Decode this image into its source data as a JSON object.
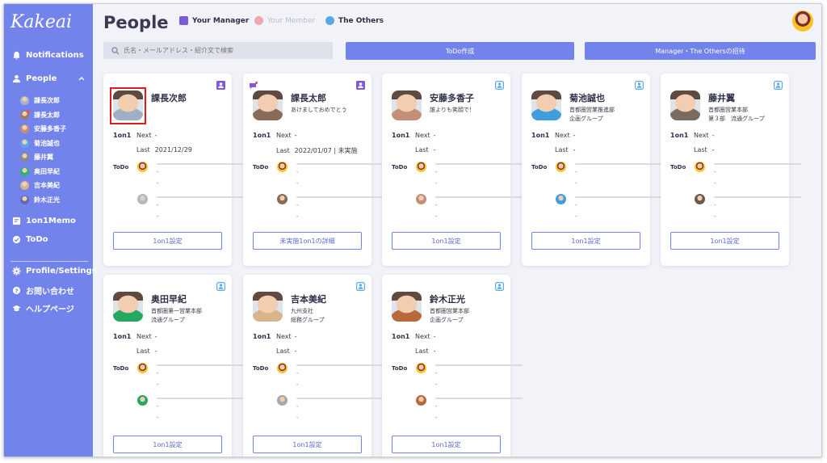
{
  "app": {
    "logo": "Kakeai"
  },
  "sidebar": {
    "notifications": "Notifications",
    "people": "People",
    "members": [
      {
        "name": "課長次郎",
        "color": "#a9b3c7"
      },
      {
        "name": "課長太郎",
        "color": "#9a7b66",
        "badge": true
      },
      {
        "name": "安藤多香子",
        "color": "#c48f78"
      },
      {
        "name": "菊池誠也",
        "color": "#5aa9e6"
      },
      {
        "name": "藤井翼",
        "color": "#8a8a8a"
      },
      {
        "name": "奥田早紀",
        "color": "#2fb36d"
      },
      {
        "name": "吉本美紀",
        "color": "#d2b48c"
      },
      {
        "name": "鈴木正光",
        "color": "#5f6ea0"
      }
    ],
    "memo": "1on1Memo",
    "todo": "ToDo",
    "profile": "Profile/Settings",
    "contact": "お問い合わせ",
    "help": "ヘルプページ"
  },
  "header": {
    "title": "People",
    "filters": {
      "manager": "Your Manager",
      "member": "Your Member",
      "others": "The Others"
    },
    "filter_colors": {
      "manager": "#7b5bd6",
      "member": "#f2a6ae",
      "others": "#5aa9e6"
    }
  },
  "search": {
    "placeholder": "氏名・メールアドレス・紹介文で検索"
  },
  "actions": {
    "todo_create": "ToDo作成",
    "invite": "Manager・The Othersの招待"
  },
  "card_labels": {
    "oneonone": "1on1",
    "next": "Next",
    "last": "Last",
    "todo": "ToDo",
    "dash": "-"
  },
  "cards": [
    {
      "name": "課長次郎",
      "line1": "",
      "line2": "",
      "next": "-",
      "last": "2021/12/29",
      "button": "1on1設定",
      "role": "manager",
      "photo": "#9fb0c4",
      "todo2": "#b0b8c8"
    },
    {
      "name": "課長太郎",
      "line1": "あけましておめでとう",
      "line2": "",
      "next": "-",
      "last": "2022/01/07 | 未実施",
      "button": "未実施1on1の詳細",
      "role": "manager",
      "photo": "#8a6a58",
      "todo2": "#8a6a58",
      "badge": true
    },
    {
      "name": "安藤多香子",
      "line1": "誰よりも笑顔で！",
      "line2": "",
      "next": "-",
      "last": "-",
      "button": "1on1設定",
      "role": "others",
      "photo": "#c48f78",
      "todo2": "#c48f78"
    },
    {
      "name": "菊池誠也",
      "line1": "首都圏営業推進部",
      "line2": "企画グループ",
      "next": "-",
      "last": "-",
      "button": "1on1設定",
      "role": "others",
      "photo": "#3f9de0",
      "todo2": "#3f9de0"
    },
    {
      "name": "藤井翼",
      "line1": "首都圏営業本部",
      "line2": "第３部　流通グループ",
      "next": "-",
      "last": "-",
      "button": "1on1設定",
      "role": "others",
      "photo": "#7a6a60",
      "todo2": "#6b5a50"
    },
    {
      "name": "奥田早紀",
      "line1": "首都圏第一営業本部",
      "line2": "流通グループ",
      "next": "-",
      "last": "-",
      "button": "1on1設定",
      "role": "others",
      "photo": "#25a862",
      "todo2": "#25a862"
    },
    {
      "name": "吉本美紀",
      "line1": "九州支社",
      "line2": "総務グループ",
      "next": "-",
      "last": "-",
      "button": "1on1設定",
      "role": "others",
      "photo": "#d8b48a",
      "todo2": "#a0a8b8"
    },
    {
      "name": "鈴木正光",
      "line1": "首都圏営業本部",
      "line2": "企画グループ",
      "next": "-",
      "last": "-",
      "button": "1on1設定",
      "role": "others",
      "photo": "#b66a3a",
      "todo2": "#b66a3a"
    }
  ]
}
